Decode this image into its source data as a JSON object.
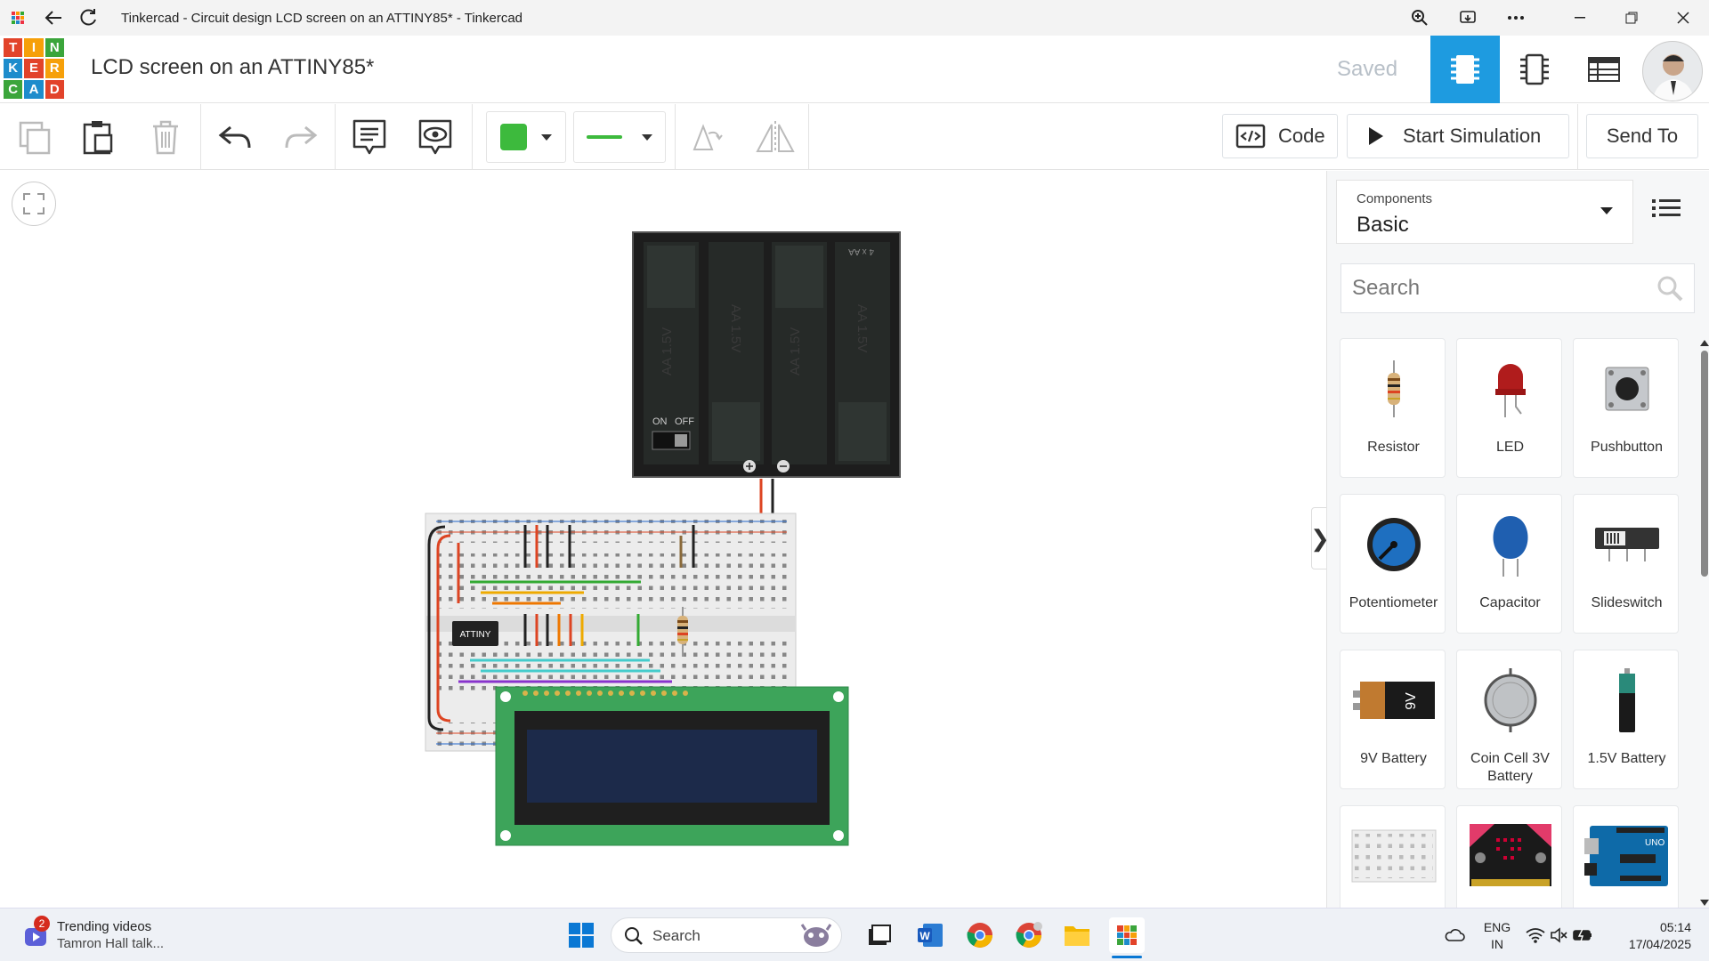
{
  "window": {
    "title": "Tinkercad - Circuit design LCD screen on an ATTINY85* - Tinkercad"
  },
  "header": {
    "logo_letters": [
      "T",
      "I",
      "N",
      "K",
      "E",
      "R",
      "C",
      "A",
      "D"
    ],
    "project_title": "LCD screen on an ATTINY85*",
    "save_status": "Saved"
  },
  "toolbar": {
    "code_label": "Code",
    "simulate_label": "Start Simulation",
    "send_label": "Send To",
    "fill_color": "#3dba3d",
    "wire_color": "#3dba3d"
  },
  "canvas": {
    "battery_label": "4 x AA",
    "cell_label": "AA 1.5V",
    "switch_on": "ON",
    "switch_off": "OFF",
    "chip_label": "ATTINY"
  },
  "panel": {
    "components_label": "Components",
    "components_value": "Basic",
    "search_placeholder": "Search",
    "items": [
      {
        "name": "Resistor",
        "icon": "resistor-icon"
      },
      {
        "name": "LED",
        "icon": "led-icon"
      },
      {
        "name": "Pushbutton",
        "icon": "pushbutton-icon"
      },
      {
        "name": "Potentiometer",
        "icon": "potentiometer-icon"
      },
      {
        "name": "Capacitor",
        "icon": "capacitor-icon"
      },
      {
        "name": "Slideswitch",
        "icon": "slideswitch-icon"
      },
      {
        "name": "9V Battery",
        "icon": "battery-9v-icon"
      },
      {
        "name": "Coin Cell 3V Battery",
        "icon": "coin-cell-icon"
      },
      {
        "name": "1.5V Battery",
        "icon": "battery-aa-icon"
      },
      {
        "name": "",
        "icon": "breadboard-icon"
      },
      {
        "name": "",
        "icon": "microbit-icon"
      },
      {
        "name": "",
        "icon": "arduino-icon"
      }
    ]
  },
  "taskbar": {
    "news_badge": "2",
    "news_title": "Trending videos",
    "news_sub": "Tamron Hall talk...",
    "search_label": "Search",
    "lang_line1": "ENG",
    "lang_line2": "IN",
    "time": "05:14",
    "date": "17/04/2025"
  }
}
